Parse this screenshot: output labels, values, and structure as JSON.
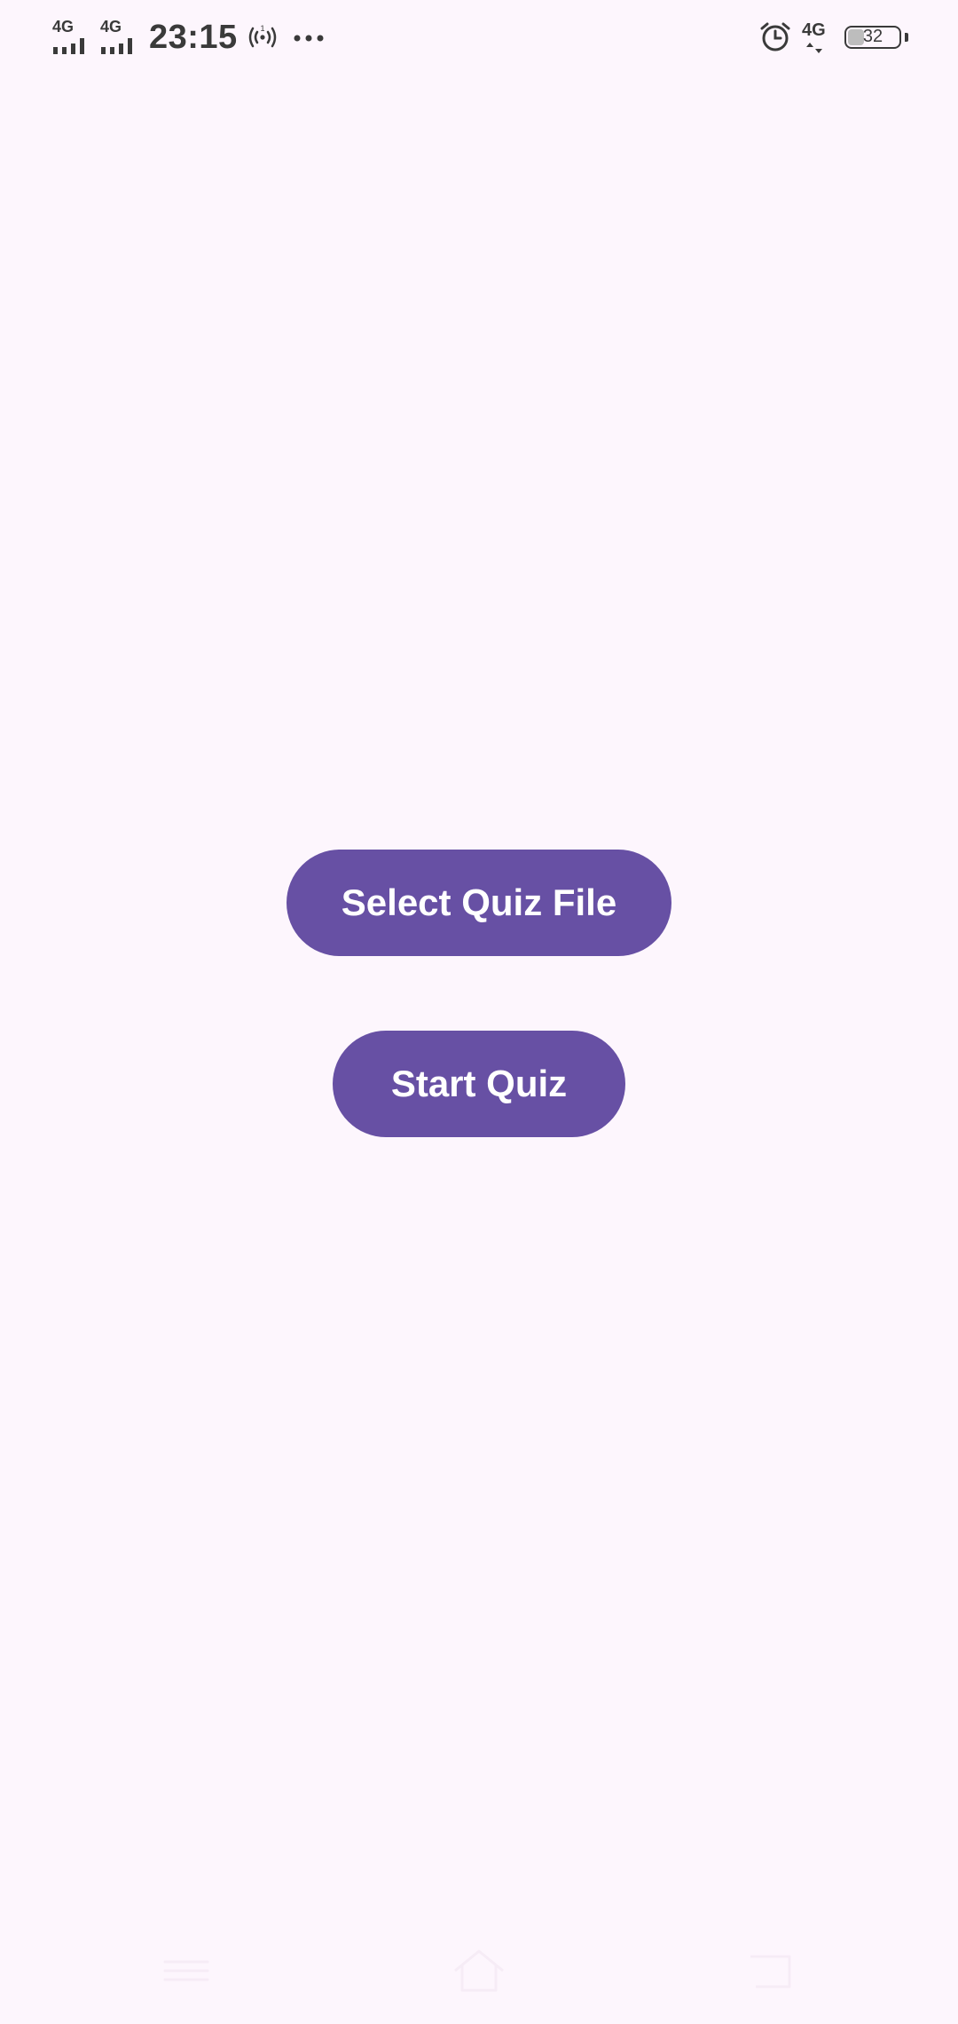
{
  "status_bar": {
    "signal1_label": "4G",
    "signal2_label": "4G",
    "time": "23:15",
    "battery_level": "32",
    "network_right_label": "4G",
    "icons": [
      "signal-icon",
      "signal-icon",
      "hotspot-icon",
      "more-icon",
      "alarm-icon",
      "network-4g-icon",
      "battery-icon"
    ]
  },
  "main": {
    "select_quiz_label": "Select Quiz File",
    "start_quiz_label": "Start Quiz"
  },
  "navigation_bar": {
    "icons": [
      "menu-icon",
      "home-icon",
      "back-icon"
    ]
  },
  "colors": {
    "background": "#fdf6fd",
    "primary_button": "#6750a4",
    "button_text": "#ffffff",
    "status_text": "#3a3a3a"
  }
}
